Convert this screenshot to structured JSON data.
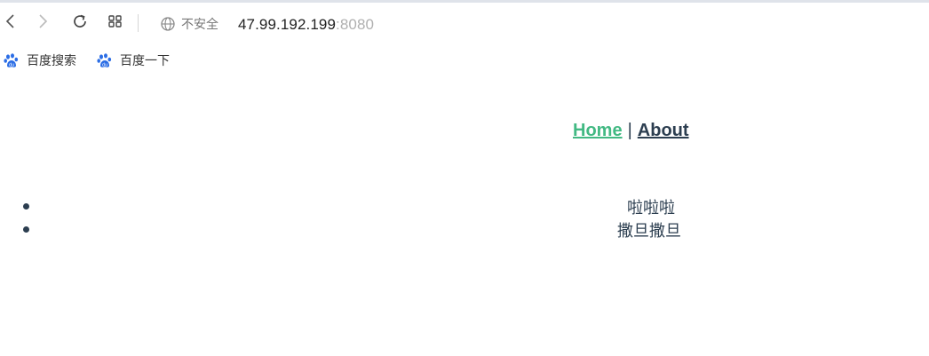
{
  "browser": {
    "security_label": "不安全",
    "url_host": "47.99.192.199",
    "url_port": ":8080",
    "bookmarks": [
      {
        "label": "百度搜索",
        "icon": "baidu-paw-icon"
      },
      {
        "label": "百度一下",
        "icon": "baidu-paw-icon"
      }
    ]
  },
  "nav": {
    "home_label": "Home",
    "separator": "|",
    "about_label": "About"
  },
  "list": {
    "items": [
      "啦啦啦",
      "撒旦撒旦"
    ]
  },
  "colors": {
    "link_active": "#42b983",
    "text": "#2c3e50",
    "baidu_blue": "#2b6de5"
  }
}
